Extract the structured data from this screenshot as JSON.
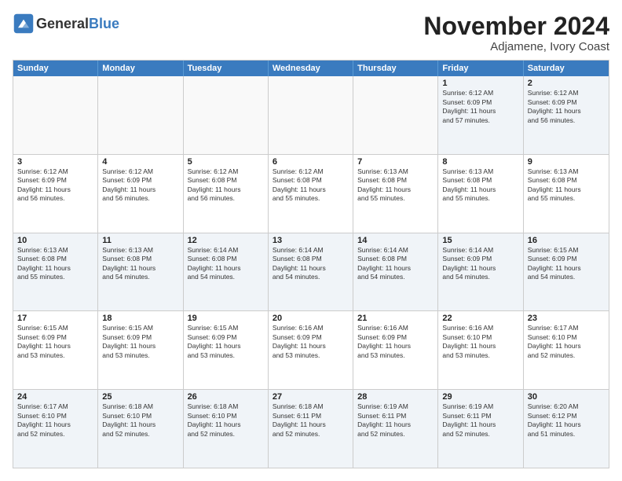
{
  "logo": {
    "general": "General",
    "blue": "Blue"
  },
  "header": {
    "month": "November 2024",
    "location": "Adjamene, Ivory Coast"
  },
  "weekdays": [
    "Sunday",
    "Monday",
    "Tuesday",
    "Wednesday",
    "Thursday",
    "Friday",
    "Saturday"
  ],
  "rows": [
    [
      {
        "day": "",
        "info": ""
      },
      {
        "day": "",
        "info": ""
      },
      {
        "day": "",
        "info": ""
      },
      {
        "day": "",
        "info": ""
      },
      {
        "day": "",
        "info": ""
      },
      {
        "day": "1",
        "info": "Sunrise: 6:12 AM\nSunset: 6:09 PM\nDaylight: 11 hours\nand 57 minutes."
      },
      {
        "day": "2",
        "info": "Sunrise: 6:12 AM\nSunset: 6:09 PM\nDaylight: 11 hours\nand 56 minutes."
      }
    ],
    [
      {
        "day": "3",
        "info": "Sunrise: 6:12 AM\nSunset: 6:09 PM\nDaylight: 11 hours\nand 56 minutes."
      },
      {
        "day": "4",
        "info": "Sunrise: 6:12 AM\nSunset: 6:09 PM\nDaylight: 11 hours\nand 56 minutes."
      },
      {
        "day": "5",
        "info": "Sunrise: 6:12 AM\nSunset: 6:08 PM\nDaylight: 11 hours\nand 56 minutes."
      },
      {
        "day": "6",
        "info": "Sunrise: 6:12 AM\nSunset: 6:08 PM\nDaylight: 11 hours\nand 55 minutes."
      },
      {
        "day": "7",
        "info": "Sunrise: 6:13 AM\nSunset: 6:08 PM\nDaylight: 11 hours\nand 55 minutes."
      },
      {
        "day": "8",
        "info": "Sunrise: 6:13 AM\nSunset: 6:08 PM\nDaylight: 11 hours\nand 55 minutes."
      },
      {
        "day": "9",
        "info": "Sunrise: 6:13 AM\nSunset: 6:08 PM\nDaylight: 11 hours\nand 55 minutes."
      }
    ],
    [
      {
        "day": "10",
        "info": "Sunrise: 6:13 AM\nSunset: 6:08 PM\nDaylight: 11 hours\nand 55 minutes."
      },
      {
        "day": "11",
        "info": "Sunrise: 6:13 AM\nSunset: 6:08 PM\nDaylight: 11 hours\nand 54 minutes."
      },
      {
        "day": "12",
        "info": "Sunrise: 6:14 AM\nSunset: 6:08 PM\nDaylight: 11 hours\nand 54 minutes."
      },
      {
        "day": "13",
        "info": "Sunrise: 6:14 AM\nSunset: 6:08 PM\nDaylight: 11 hours\nand 54 minutes."
      },
      {
        "day": "14",
        "info": "Sunrise: 6:14 AM\nSunset: 6:08 PM\nDaylight: 11 hours\nand 54 minutes."
      },
      {
        "day": "15",
        "info": "Sunrise: 6:14 AM\nSunset: 6:09 PM\nDaylight: 11 hours\nand 54 minutes."
      },
      {
        "day": "16",
        "info": "Sunrise: 6:15 AM\nSunset: 6:09 PM\nDaylight: 11 hours\nand 54 minutes."
      }
    ],
    [
      {
        "day": "17",
        "info": "Sunrise: 6:15 AM\nSunset: 6:09 PM\nDaylight: 11 hours\nand 53 minutes."
      },
      {
        "day": "18",
        "info": "Sunrise: 6:15 AM\nSunset: 6:09 PM\nDaylight: 11 hours\nand 53 minutes."
      },
      {
        "day": "19",
        "info": "Sunrise: 6:15 AM\nSunset: 6:09 PM\nDaylight: 11 hours\nand 53 minutes."
      },
      {
        "day": "20",
        "info": "Sunrise: 6:16 AM\nSunset: 6:09 PM\nDaylight: 11 hours\nand 53 minutes."
      },
      {
        "day": "21",
        "info": "Sunrise: 6:16 AM\nSunset: 6:09 PM\nDaylight: 11 hours\nand 53 minutes."
      },
      {
        "day": "22",
        "info": "Sunrise: 6:16 AM\nSunset: 6:10 PM\nDaylight: 11 hours\nand 53 minutes."
      },
      {
        "day": "23",
        "info": "Sunrise: 6:17 AM\nSunset: 6:10 PM\nDaylight: 11 hours\nand 52 minutes."
      }
    ],
    [
      {
        "day": "24",
        "info": "Sunrise: 6:17 AM\nSunset: 6:10 PM\nDaylight: 11 hours\nand 52 minutes."
      },
      {
        "day": "25",
        "info": "Sunrise: 6:18 AM\nSunset: 6:10 PM\nDaylight: 11 hours\nand 52 minutes."
      },
      {
        "day": "26",
        "info": "Sunrise: 6:18 AM\nSunset: 6:10 PM\nDaylight: 11 hours\nand 52 minutes."
      },
      {
        "day": "27",
        "info": "Sunrise: 6:18 AM\nSunset: 6:11 PM\nDaylight: 11 hours\nand 52 minutes."
      },
      {
        "day": "28",
        "info": "Sunrise: 6:19 AM\nSunset: 6:11 PM\nDaylight: 11 hours\nand 52 minutes."
      },
      {
        "day": "29",
        "info": "Sunrise: 6:19 AM\nSunset: 6:11 PM\nDaylight: 11 hours\nand 52 minutes."
      },
      {
        "day": "30",
        "info": "Sunrise: 6:20 AM\nSunset: 6:12 PM\nDaylight: 11 hours\nand 51 minutes."
      }
    ]
  ]
}
